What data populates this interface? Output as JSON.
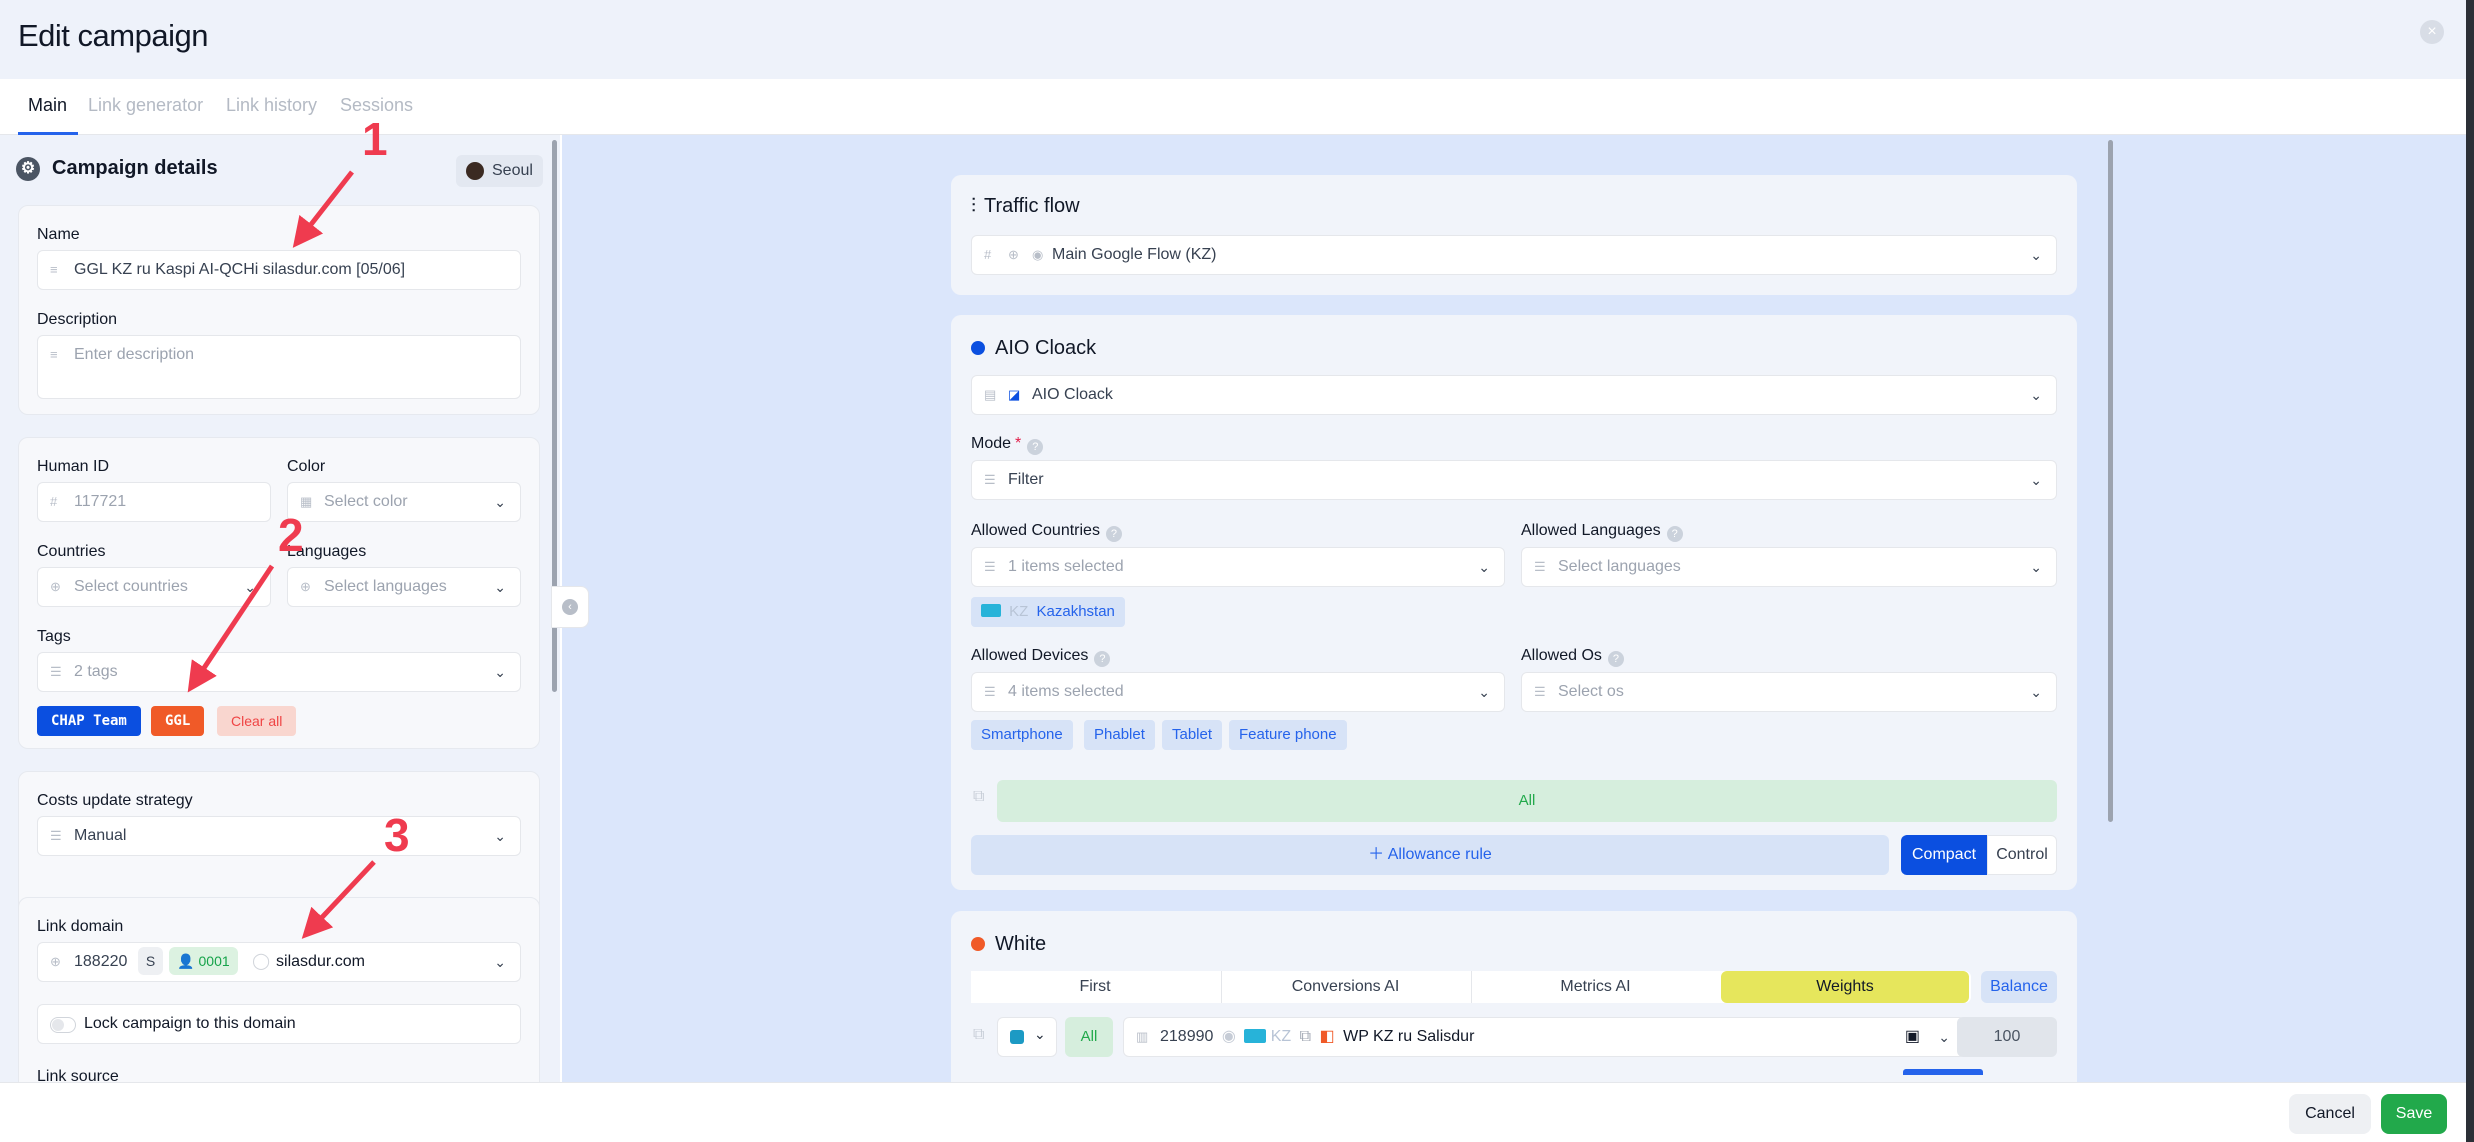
{
  "header": {
    "title": "Edit campaign"
  },
  "tabs": [
    {
      "label": "Main"
    },
    {
      "label": "Link generator"
    },
    {
      "label": "Link history"
    },
    {
      "label": "Sessions"
    }
  ],
  "left": {
    "section_title": "Campaign details",
    "timezone": "Seoul",
    "name": {
      "label": "Name",
      "value": "GGL KZ ru Kaspi AI-QCHi silasdur.com [05/06]"
    },
    "description": {
      "label": "Description",
      "placeholder": "Enter description"
    },
    "human_id": {
      "label": "Human ID",
      "value": "117721"
    },
    "color": {
      "label": "Color",
      "placeholder": "Select color"
    },
    "countries": {
      "label": "Countries",
      "placeholder": "Select countries"
    },
    "languages": {
      "label": "Languages",
      "placeholder": "Select languages"
    },
    "tags": {
      "label": "Tags",
      "summary": "2 tags",
      "items": [
        {
          "label": "CHAP Team",
          "color": "#0b4fe0"
        },
        {
          "label": "GGL",
          "color": "#f05a28"
        }
      ],
      "clear_label": "Clear all"
    },
    "costs": {
      "label": "Costs update strategy",
      "value": "Manual"
    },
    "link_domain": {
      "label": "Link domain",
      "id": "188220",
      "badge_s": "S",
      "badge_user": "0001",
      "domain": "silasdur.com"
    },
    "lock_label": "Lock campaign to this domain",
    "link_source_label": "Link source"
  },
  "right": {
    "traffic_flow": {
      "title": "Traffic flow",
      "value": "Main Google Flow (KZ)"
    },
    "aio": {
      "title": "AIO Cloack",
      "dot_color": "#0b4fe0",
      "select_value": "AIO Cloack",
      "mode_label": "Mode",
      "mode_value": "Filter",
      "countries_label": "Allowed Countries",
      "countries_value": "1 items selected",
      "country_chip_code": "KZ",
      "country_chip_name": "Kazakhstan",
      "languages_label": "Allowed Languages",
      "languages_placeholder": "Select languages",
      "devices_label": "Allowed Devices",
      "devices_value": "4 items selected",
      "devices": [
        "Smartphone",
        "Phablet",
        "Tablet",
        "Feature phone"
      ],
      "os_label": "Allowed Os",
      "os_placeholder": "Select os",
      "all_label": "All",
      "allowance_label": "Allowance rule",
      "compact_label": "Compact",
      "control_label": "Control"
    },
    "white": {
      "title": "White",
      "dot_color": "#f05a28",
      "modes": [
        "First",
        "Conversions AI",
        "Metrics AI",
        "Weights"
      ],
      "balance_label": "Balance",
      "row": {
        "all_label": "All",
        "id": "218990",
        "country": "KZ",
        "name": "WP KZ ru Salisdur",
        "weight": "100"
      }
    }
  },
  "footer": {
    "cancel_label": "Cancel",
    "save_label": "Save"
  },
  "annotations": [
    "1",
    "2",
    "3"
  ]
}
